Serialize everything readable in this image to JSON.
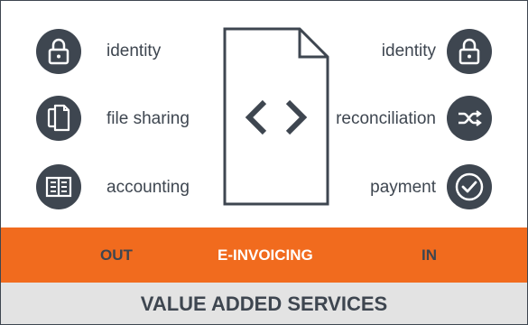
{
  "left_services": [
    {
      "label": "identity",
      "icon": "lock-icon"
    },
    {
      "label": "file sharing",
      "icon": "documents-icon"
    },
    {
      "label": "accounting",
      "icon": "ledger-book-icon"
    }
  ],
  "right_services": [
    {
      "label": "identity",
      "icon": "lock-icon"
    },
    {
      "label": "reconciliation",
      "icon": "shuffle-arrows-icon"
    },
    {
      "label": "payment",
      "icon": "check-circle-icon"
    }
  ],
  "center_document": {
    "icon": "code-document-icon"
  },
  "band": {
    "out_label": "OUT",
    "center_label": "E-INVOICING",
    "in_label": "IN"
  },
  "footer": {
    "label": "VALUE ADDED SERVICES"
  },
  "colors": {
    "dark": "#3e4650",
    "accent": "#f16b1e",
    "footer_bg": "#e3e3e3"
  }
}
